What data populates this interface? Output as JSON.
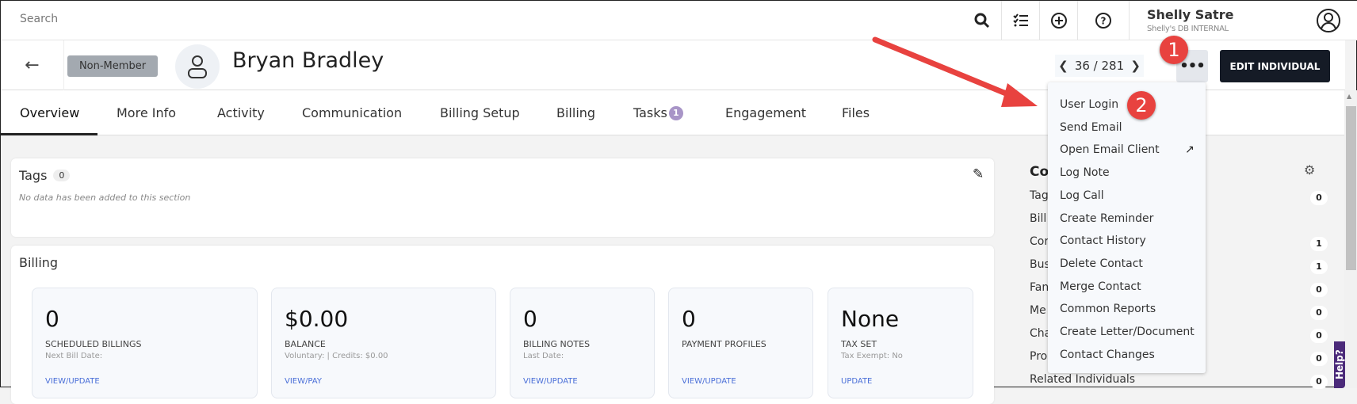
{
  "topbar": {
    "search_placeholder": "Search",
    "user_name": "Shelly Satre",
    "user_db": "Shelly's DB INTERNAL",
    "icons": [
      "search-icon",
      "checklist-icon",
      "plus-circle-icon",
      "help-circle-icon",
      "user-circle-icon"
    ]
  },
  "header": {
    "badge": "Non-Member",
    "name": "Bryan Bradley",
    "pager": "36 / 281",
    "more": "•••",
    "edit_label": "EDIT INDIVIDUAL"
  },
  "tabs": [
    {
      "label": "Overview"
    },
    {
      "label": "More Info"
    },
    {
      "label": "Activity"
    },
    {
      "label": "Communication"
    },
    {
      "label": "Billing Setup"
    },
    {
      "label": "Billing"
    },
    {
      "label": "Tasks",
      "badge": "1"
    },
    {
      "label": "Engagement"
    },
    {
      "label": "Files"
    }
  ],
  "tags": {
    "title": "Tags",
    "count": "0",
    "empty": "No data has been added to this section"
  },
  "billing": {
    "title": "Billing",
    "cards": [
      {
        "value": "0",
        "label": "SCHEDULED BILLINGS",
        "sub": "Next Bill Date:",
        "link": "VIEW/UPDATE"
      },
      {
        "value": "$0.00",
        "label": "BALANCE",
        "sub": "Voluntary: | Credits: $0.00",
        "link": "VIEW/PAY"
      },
      {
        "value": "0",
        "label": "BILLING NOTES",
        "sub": "Last Date:",
        "link": "VIEW/UPDATE"
      },
      {
        "value": "0",
        "label": "PAYMENT PROFILES",
        "sub": "",
        "link": "VIEW/UPDATE"
      },
      {
        "value": "None",
        "label": "TAX SET",
        "sub": "Tax Exempt: No",
        "link": "UPDATE"
      }
    ]
  },
  "right_panel": {
    "title": "Co",
    "rows": [
      {
        "label": "Tag",
        "count": "0"
      },
      {
        "label": "Bill",
        "count": ""
      },
      {
        "label": "Cor",
        "count": "1"
      },
      {
        "label": "Bus",
        "count": "1"
      },
      {
        "label": "Fan",
        "count": "0"
      },
      {
        "label": "Me",
        "count": "0"
      },
      {
        "label": "Cha",
        "count": "0"
      },
      {
        "label": "Pro",
        "count": "0"
      },
      {
        "label": "Related Individuals",
        "count": "0"
      }
    ]
  },
  "menu": {
    "items": [
      "User Login",
      "Send Email",
      "Open Email Client",
      "Log Note",
      "Log Call",
      "Create Reminder",
      "Contact History",
      "Delete Contact",
      "Merge Contact",
      "Common Reports",
      "Create Letter/Document",
      "Contact Changes"
    ]
  },
  "help_tab": "Help?",
  "annotations": {
    "step1": "1",
    "step2": "2",
    "color": "#e8423f"
  }
}
